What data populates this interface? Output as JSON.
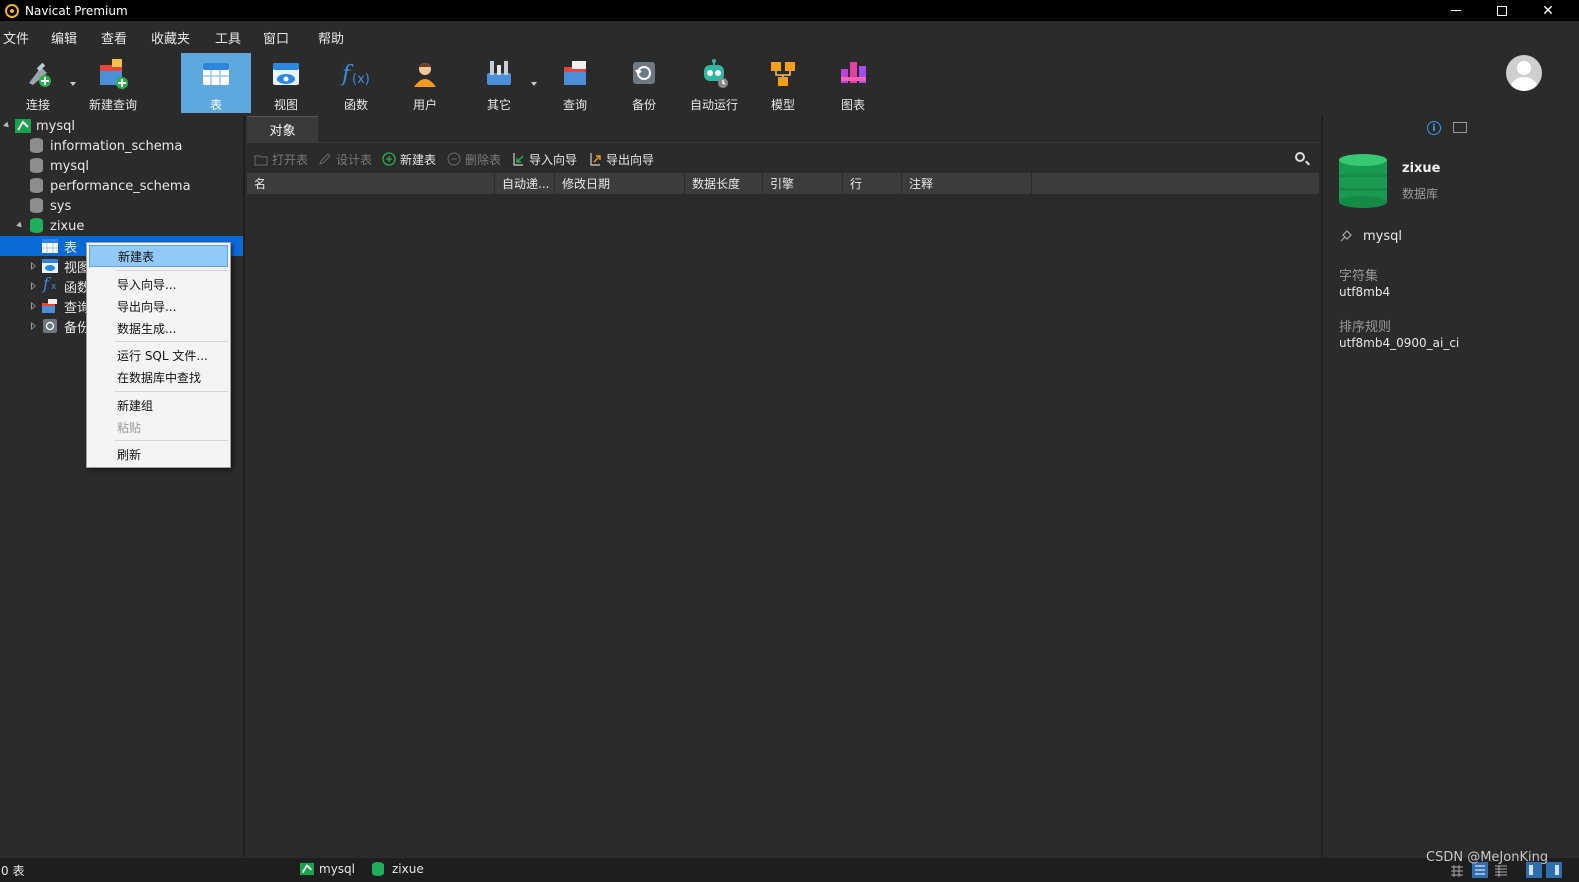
{
  "window": {
    "title": "Navicat Premium"
  },
  "menu": [
    "文件",
    "编辑",
    "查看",
    "收藏夹",
    "工具",
    "窗口",
    "帮助"
  ],
  "toolbar": {
    "items": [
      {
        "label": "连接",
        "icon": "plug-icon"
      },
      {
        "label": "新建查询",
        "icon": "new-query-icon"
      },
      {
        "label": "表",
        "icon": "table-icon"
      },
      {
        "label": "视图",
        "icon": "view-icon"
      },
      {
        "label": "函数",
        "icon": "function-icon"
      },
      {
        "label": "用户",
        "icon": "user-icon"
      },
      {
        "label": "其它",
        "icon": "tools-icon"
      },
      {
        "label": "查询",
        "icon": "query-icon"
      },
      {
        "label": "备份",
        "icon": "backup-icon"
      },
      {
        "label": "自动运行",
        "icon": "robot-icon"
      },
      {
        "label": "模型",
        "icon": "model-icon"
      },
      {
        "label": "图表",
        "icon": "chart-icon"
      }
    ]
  },
  "tree": {
    "connection": "mysql",
    "databases": [
      "information_schema",
      "mysql",
      "performance_schema",
      "sys",
      "zixue"
    ],
    "children": [
      "表",
      "视图",
      "函数",
      "查询",
      "备份"
    ]
  },
  "context_menu": {
    "items": [
      "新建表",
      "导入向导...",
      "导出向导...",
      "数据生成...",
      "运行 SQL 文件...",
      "在数据库中查找",
      "新建组",
      "粘贴",
      "刷新"
    ]
  },
  "objects": {
    "tab": "对象",
    "toolbar": [
      "打开表",
      "设计表",
      "新建表",
      "删除表",
      "导入向导",
      "导出向导"
    ],
    "columns": [
      "名",
      "自动递...",
      "修改日期",
      "数据长度",
      "引擎",
      "行",
      "注释"
    ]
  },
  "info": {
    "db_name": "zixue",
    "db_type": "数据库",
    "connection": "mysql",
    "charset_label": "字符集",
    "charset": "utf8mb4",
    "collation_label": "排序规则",
    "collation": "utf8mb4_0900_ai_ci"
  },
  "status": {
    "count": "0 表",
    "connection": "mysql",
    "database": "zixue"
  },
  "watermark": "CSDN @MeJonKing",
  "colors": {
    "accent": "#5ea8e0",
    "selection": "#0a6ad8",
    "db_green": "#1fae5c"
  }
}
